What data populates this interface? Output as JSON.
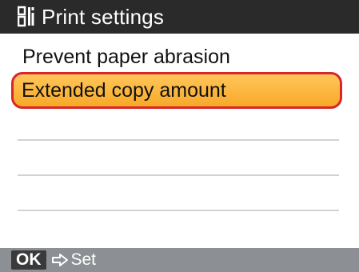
{
  "header": {
    "icon": "settings-icon",
    "title": "Print settings"
  },
  "menu": {
    "items": [
      {
        "label": "Prevent paper abrasion",
        "selected": false
      },
      {
        "label": "Extended copy amount",
        "selected": true
      }
    ],
    "empty_rows": 4
  },
  "footer": {
    "key": "OK",
    "arrow_icon": "arrow-right-icon",
    "action": "Set"
  },
  "colors": {
    "header_bg": "#2a2a2a",
    "selection_fill": "#f7a928",
    "selection_border": "#d8262a",
    "footer_bg": "#8c9094"
  }
}
